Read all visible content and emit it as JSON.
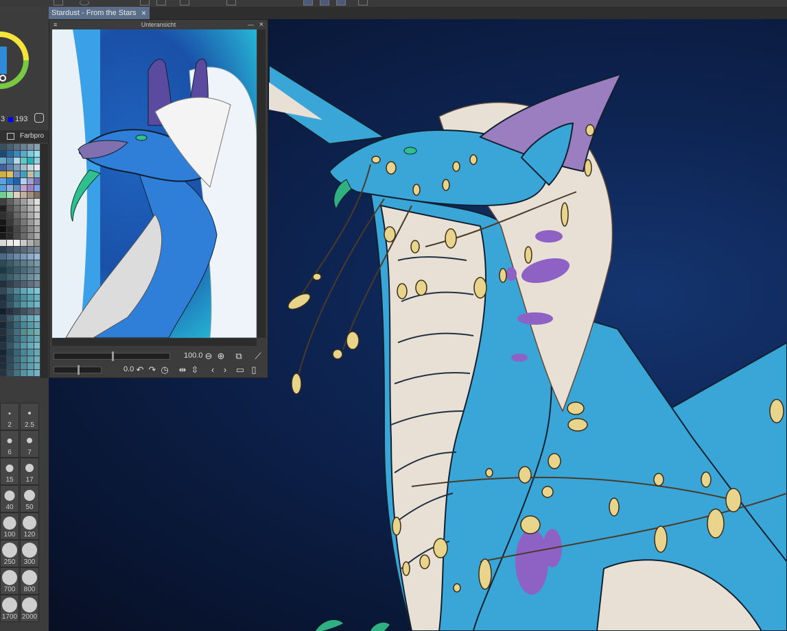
{
  "document": {
    "tab_title": "Stardust - From the Stars",
    "close_icon": "×"
  },
  "navigator": {
    "title": "Unteransicht",
    "zoom_value": "100.0",
    "rotation_value": "0.0",
    "zoom_level": 1.0,
    "rotation_level": 0.0
  },
  "color": {
    "value_a": "3",
    "value_b": "193"
  },
  "palette_panel": {
    "tab_label": "Farbpro"
  },
  "palette_colors": [
    "#3a5060",
    "#4a6070",
    "#5a7080",
    "#6a8090",
    "#7a90a0",
    "#8aa0b0",
    "#1a4a7a",
    "#2a6aa0",
    "#3a8ac0",
    "#5aaad0",
    "#7acae0",
    "#9ae0f0",
    "#6aa8c8",
    "#4a90c0",
    "#b8d8e8",
    "#60c8c0",
    "#2ab0b8",
    "#90d0e0",
    "#4060a0",
    "#6080b0",
    "#80a0c0",
    "#a0c0d0",
    "#c0d8e0",
    "#e0e8f0",
    "#d0b040",
    "#e0c060",
    "#7090c0",
    "#40a0c0",
    "#c0c0a0",
    "#80c0d0",
    "#60a0e0",
    "#3080d0",
    "#2060b0",
    "#b0d0f0",
    "#a0a0d0",
    "#7070b0",
    "#50a0e0",
    "#90b0e0",
    "#6090c0",
    "#c0a0d0",
    "#a080c0",
    "#80a0f0",
    "#70d090",
    "#a0e0b0",
    "#e0d0c0",
    "#c0b0a0",
    "#a09080",
    "#807060",
    "#404040",
    "#606060",
    "#808080",
    "#a0a0a0",
    "#c0c0c0",
    "#e0e0e0",
    "#202020",
    "#505050",
    "#707070",
    "#909090",
    "#b0b0b0",
    "#d0d0d0",
    "#303030",
    "#404040",
    "#686868",
    "#888888",
    "#a8a8a8",
    "#c8c8c8",
    "#181818",
    "#383838",
    "#585858",
    "#787878",
    "#989898",
    "#b8b8b8",
    "#101010",
    "#282828",
    "#484848",
    "#686868",
    "#888888",
    "#a8a8a8",
    "#1a1a1a",
    "#2a2a2a",
    "#4a4a4a",
    "#6a6a6a",
    "#8a8a8a",
    "#aaaaaa",
    "#d8d8d8",
    "#e8e8e8",
    "#f0f0f0",
    "#c8c8c8",
    "#b0b0b0",
    "#989898",
    "#2a3a4a",
    "#3a4a5a",
    "#4a5a6a",
    "#5a6a7a",
    "#6a7a8a",
    "#7a8a9a",
    "#4a6a8a",
    "#5a7a9a",
    "#6a8aaa",
    "#7a9aba",
    "#8aaaca",
    "#9abada",
    "#2a4a5a",
    "#3a5a6a",
    "#4a6a7a",
    "#5a7a8a",
    "#6a8a9a",
    "#7a9aaa",
    "#1a3a4a",
    "#2a4a5a",
    "#3a5a6a",
    "#4a6a7a",
    "#5a7a8a",
    "#6a8a9a",
    "#2a5060",
    "#3a6070",
    "#4a7080",
    "#5a8090",
    "#6a90a0",
    "#7aa0b0",
    "#203040",
    "#304050",
    "#405060",
    "#506070",
    "#607080",
    "#708090",
    "#304858",
    "#406878",
    "#508898",
    "#60a8b8",
    "#70b8c8",
    "#80c8d8",
    "#183040",
    "#285060",
    "#387080",
    "#4890a0",
    "#58a0b0",
    "#68b0c0",
    "#203848",
    "#305868",
    "#407888",
    "#5098a8",
    "#60a8b8",
    "#70b8c8",
    "#102030",
    "#203040",
    "#304050",
    "#405060",
    "#506070",
    "#607080",
    "#283848",
    "#385868",
    "#487888",
    "#5898a8",
    "#68a8b8",
    "#78b8c8",
    "#182838",
    "#284858",
    "#386878",
    "#488898",
    "#5898a8",
    "#68a8b8",
    "#203040",
    "#305060",
    "#407080",
    "#509090",
    "#60a0a0",
    "#70b0b0",
    "#1a2a3a",
    "#2a4a5a",
    "#3a6a7a",
    "#4a8a9a",
    "#5a9aaa",
    "#6aaaba",
    "#223344",
    "#335566",
    "#447788",
    "#5599aa",
    "#66aabb",
    "#77bbcc",
    "#162636",
    "#264656",
    "#366676",
    "#468696",
    "#5696a6",
    "#66a6b6",
    "#1c2c3c",
    "#2c4c5c",
    "#3c6c7c",
    "#4c8c9c",
    "#5c9cac",
    "#6cacbc",
    "#1e2e3e",
    "#2e4e5e",
    "#3e6e7e",
    "#4e8e9e",
    "#5e9eae",
    "#6eaebe",
    "#243444",
    "#345464",
    "#447484",
    "#5494a4",
    "#64a4b4",
    "#74b4c4"
  ],
  "brush_sizes": [
    "2",
    "2.5",
    "6",
    "7",
    "15",
    "17",
    "40",
    "50",
    "100",
    "120",
    "250",
    "300",
    "700",
    "800",
    "1700",
    "2000"
  ]
}
